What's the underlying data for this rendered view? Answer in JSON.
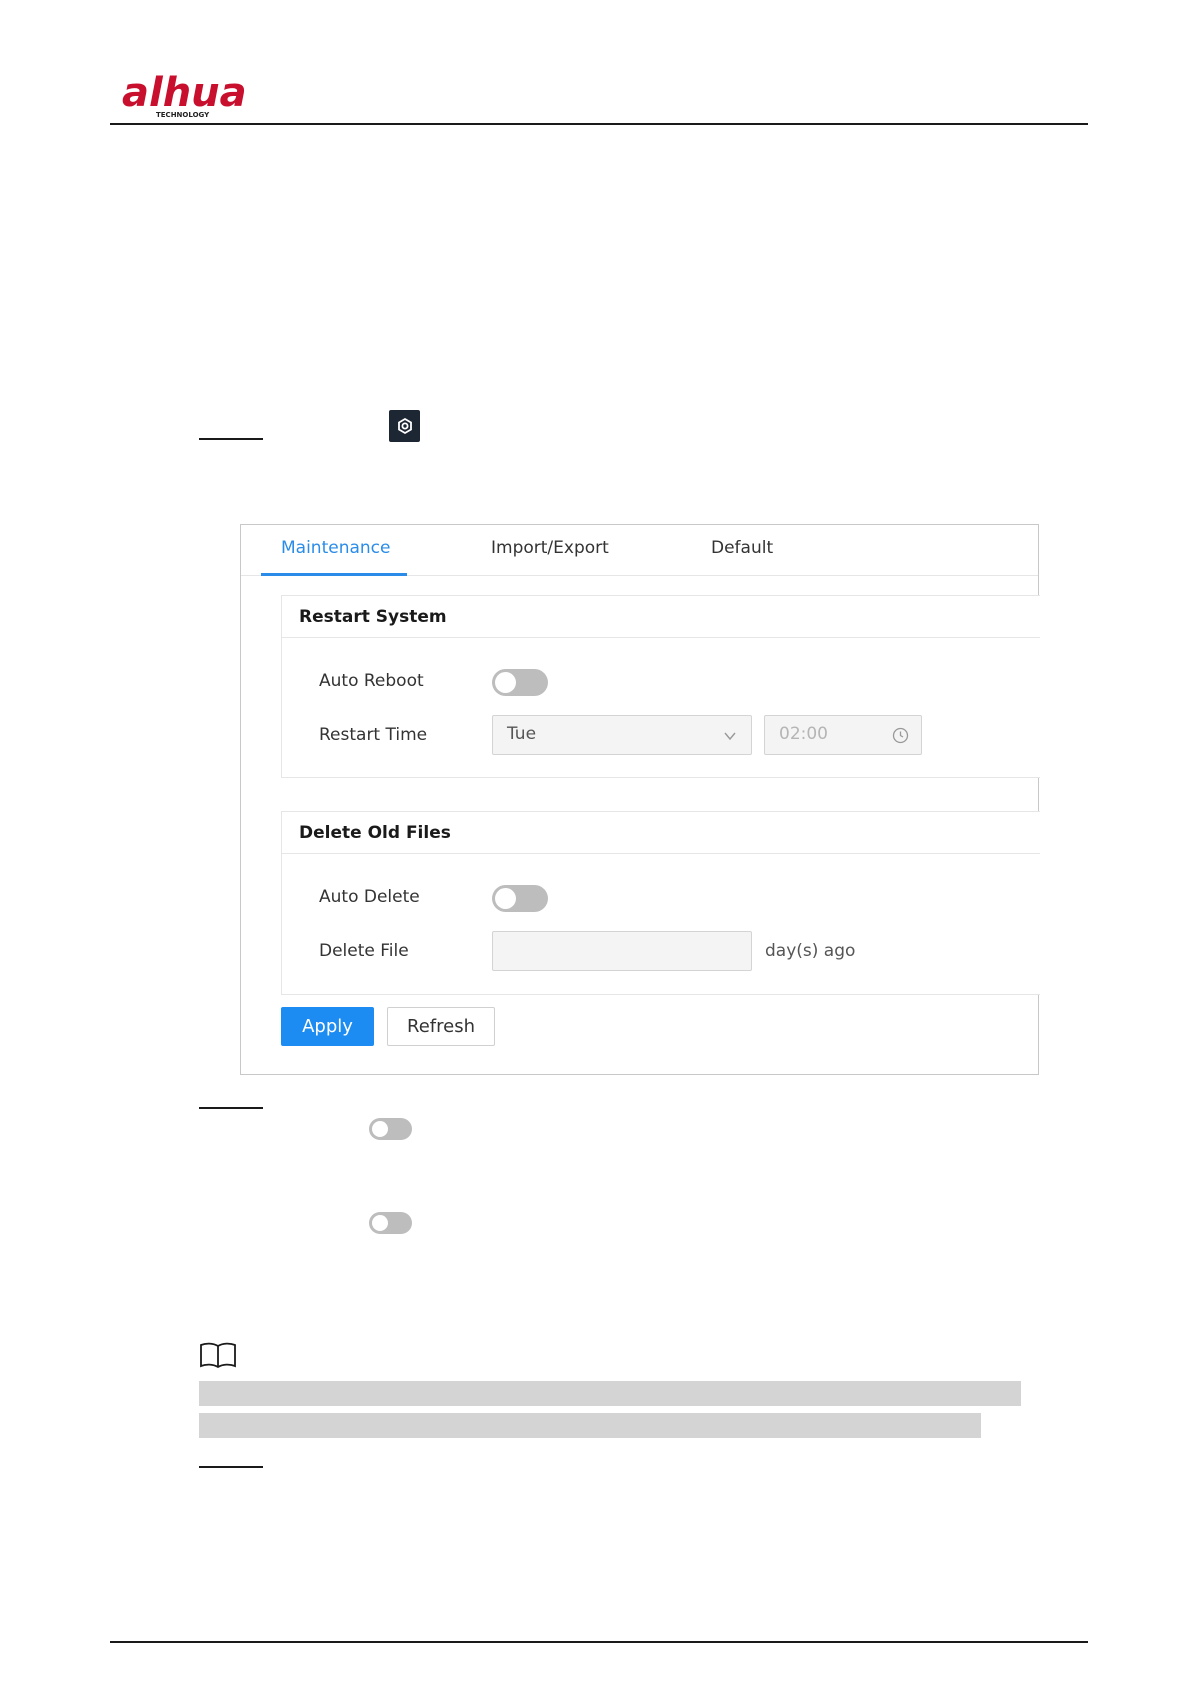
{
  "header": {
    "logo_text": "alhua",
    "logo_sub": "TECHNOLOGY"
  },
  "panel": {
    "tabs": [
      {
        "label": "Maintenance",
        "active": true
      },
      {
        "label": "Import/Export",
        "active": false
      },
      {
        "label": "Default",
        "active": false
      }
    ],
    "restart_system": {
      "title": "Restart System",
      "auto_reboot_label": "Auto Reboot",
      "auto_reboot_on": false,
      "restart_time_label": "Restart Time",
      "day_value": "Tue",
      "time_value": "02:00"
    },
    "delete_old_files": {
      "title": "Delete Old Files",
      "auto_delete_label": "Auto Delete",
      "auto_delete_on": false,
      "delete_file_label": "Delete File",
      "delete_file_value": "",
      "unit": "day(s) ago"
    },
    "apply_label": "Apply",
    "refresh_label": "Refresh"
  },
  "colors": {
    "accent": "#2a8ce8",
    "apply": "#1c8cf2",
    "toggle_off": "#bdbdbd",
    "gear_bg": "#1d2733"
  }
}
